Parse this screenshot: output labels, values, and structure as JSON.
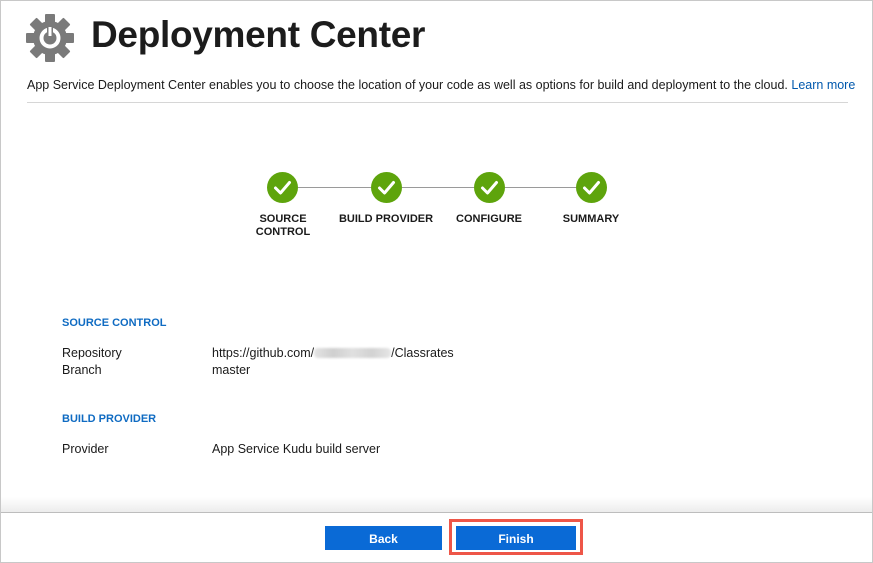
{
  "header": {
    "title": "Deployment Center",
    "icon": "gear-icon",
    "description": "App Service Deployment Center enables you to choose the location of your code as well as options for build and deployment to the cloud.",
    "learn_more": "Learn more"
  },
  "wizard": {
    "steps": [
      {
        "label_line1": "SOURCE",
        "label_line2": "CONTROL",
        "status": "complete"
      },
      {
        "label_line1": "BUILD PROVIDER",
        "label_line2": "",
        "status": "complete"
      },
      {
        "label_line1": "CONFIGURE",
        "label_line2": "",
        "status": "complete"
      },
      {
        "label_line1": "SUMMARY",
        "label_line2": "",
        "status": "complete"
      }
    ],
    "complete_color": "#5ea40c"
  },
  "summary": {
    "source_control": {
      "heading": "SOURCE CONTROL",
      "repository_label": "Repository",
      "repository_prefix": "https://github.com/",
      "repository_suffix": "/Classrates",
      "branch_label": "Branch",
      "branch_value": "master"
    },
    "build_provider": {
      "heading": "BUILD PROVIDER",
      "provider_label": "Provider",
      "provider_value": "App Service Kudu build server"
    }
  },
  "footer": {
    "back_label": "Back",
    "finish_label": "Finish",
    "button_color": "#0a6ad6",
    "highlight_color": "#ee5648"
  }
}
